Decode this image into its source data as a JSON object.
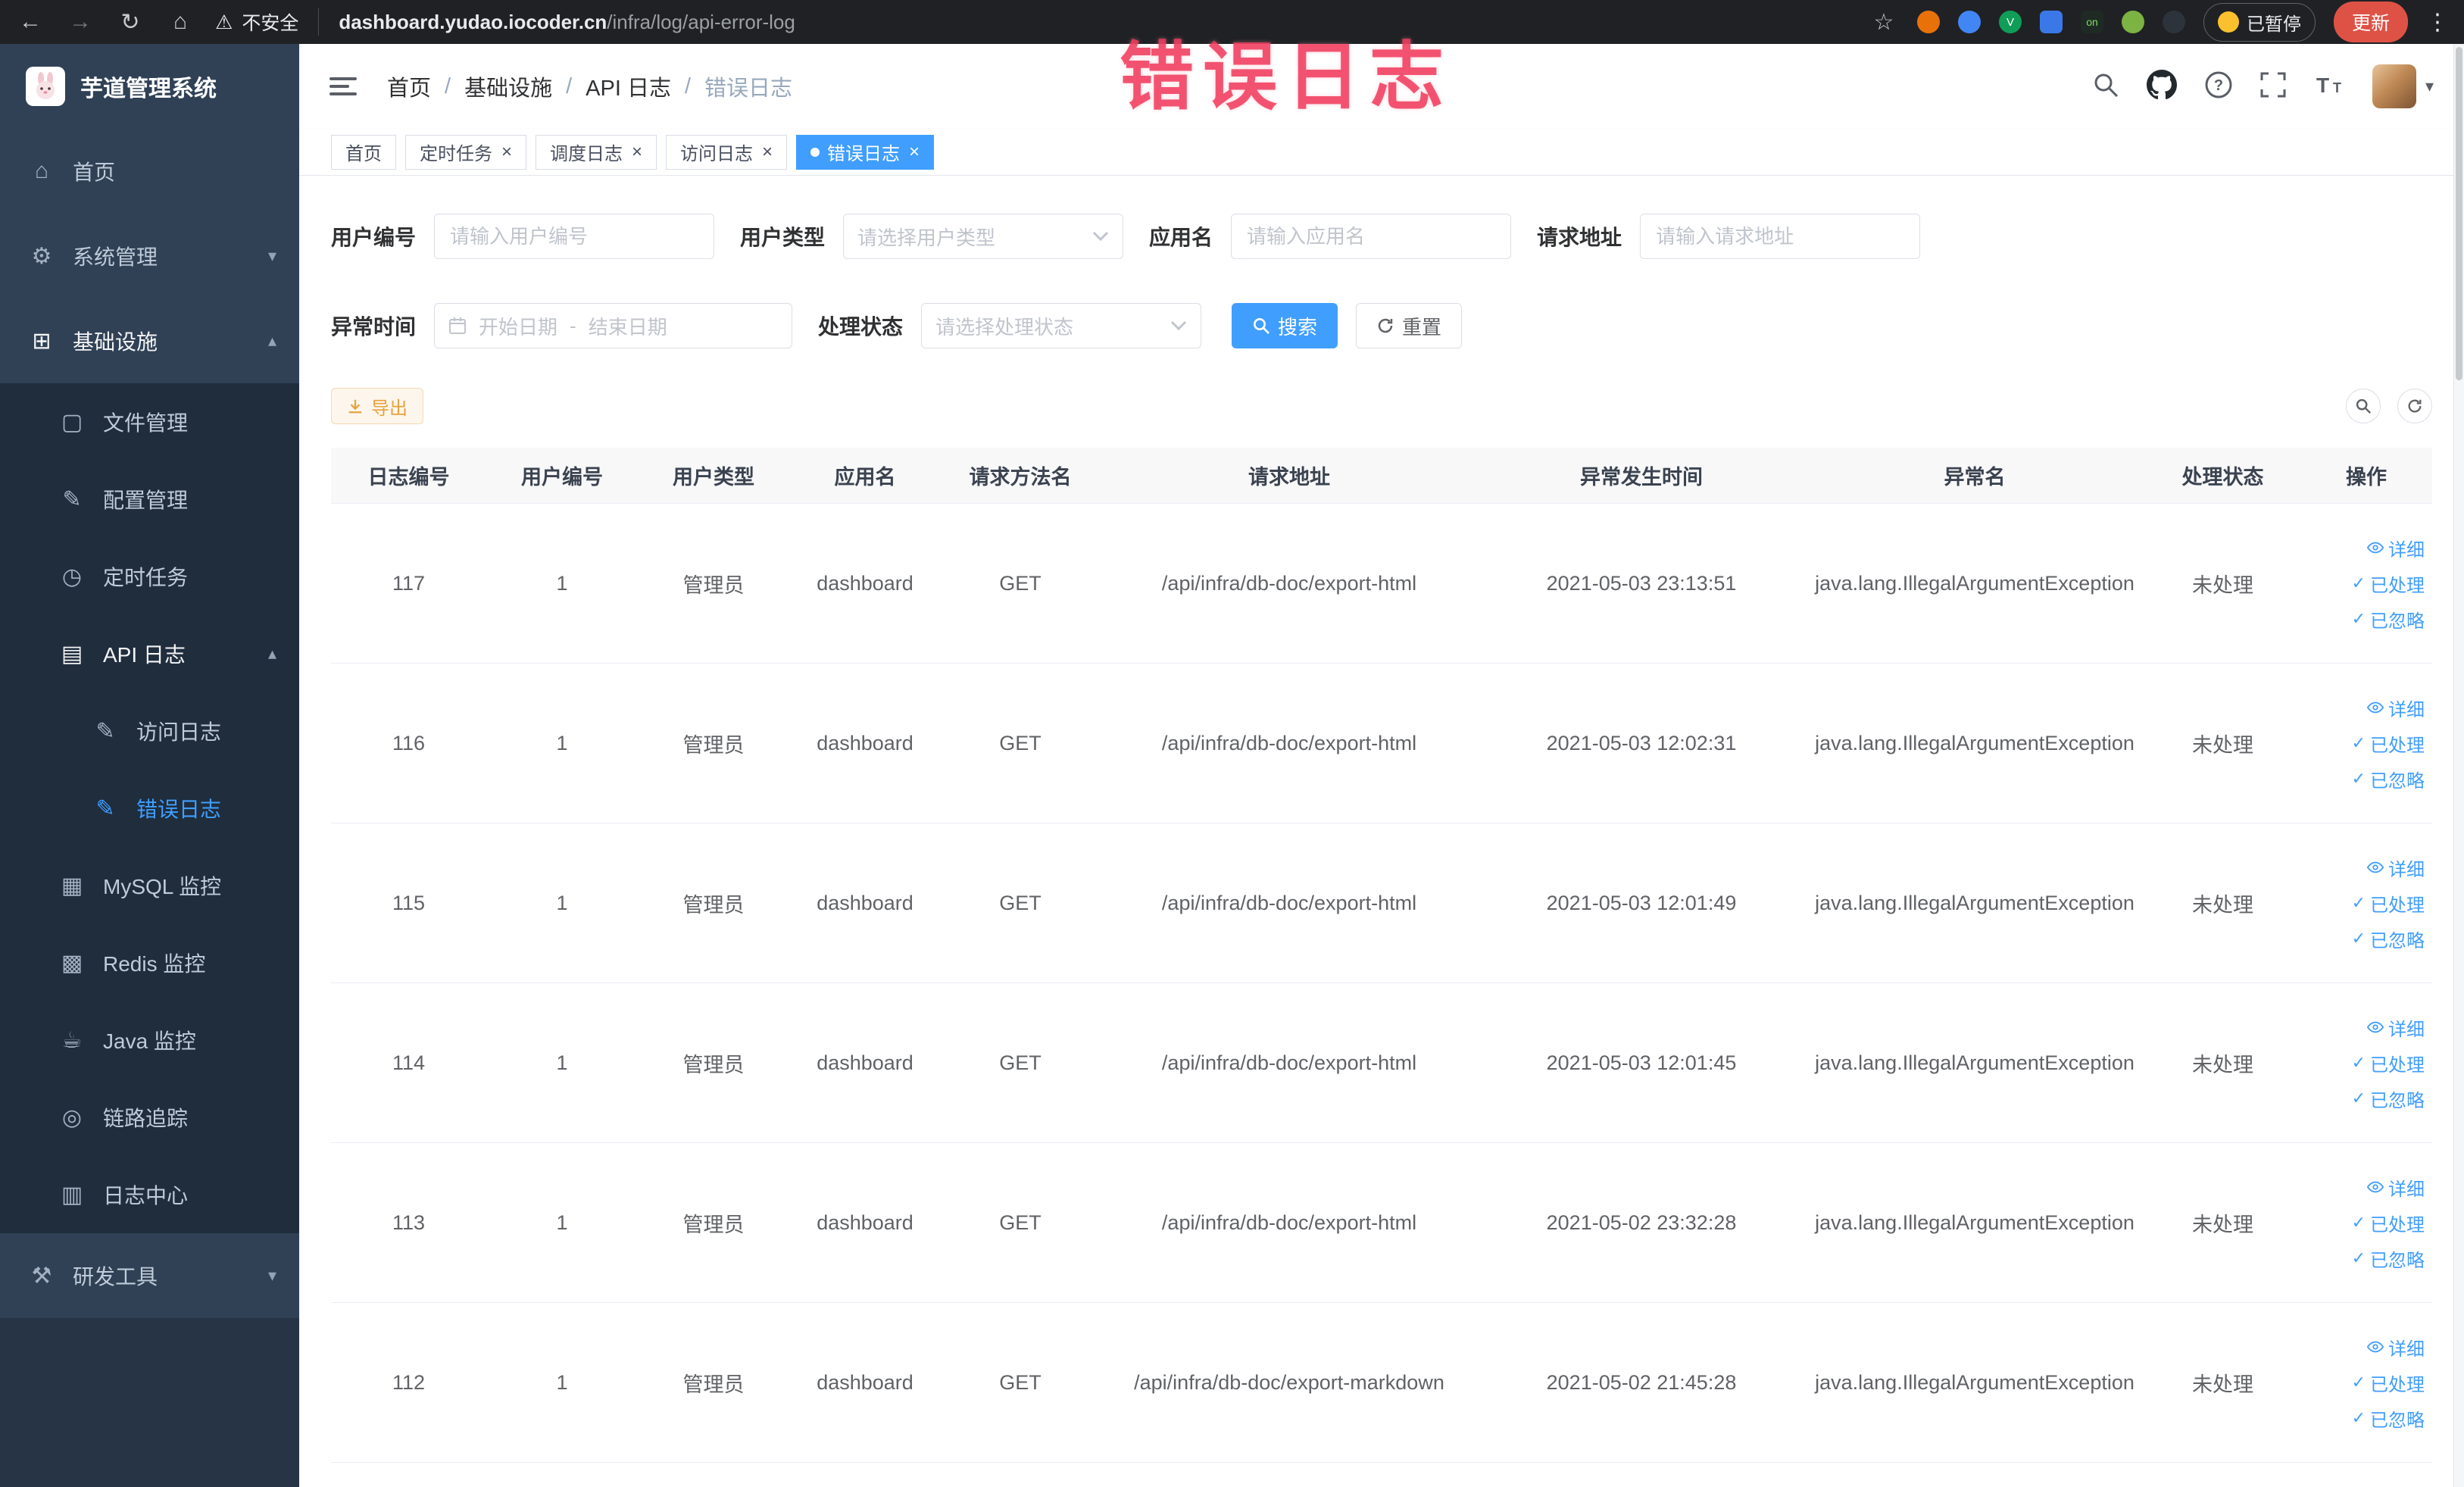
{
  "colors": {
    "accent": "#409EFF",
    "sidebar_bg": "#304156",
    "submenu_bg": "#1f2d3d",
    "warning": "#e6a23c",
    "annotation": "#f03a5c"
  },
  "browser": {
    "security_label": "不安全",
    "url_domain": "dashboard.yudao.iocoder.cn",
    "url_path": "/infra/log/api-error-log",
    "on_badge": "on",
    "paused_label": "已暂停",
    "update_label": "更新"
  },
  "icons": {
    "back": "←",
    "forward": "→",
    "reload": "↻",
    "home": "⌂",
    "warning": "⚠",
    "star": "☆",
    "kebab": "⋮",
    "close": "×",
    "check": "✓",
    "caret_down": "▾",
    "caret_up": "▴",
    "menu_home": "⌂",
    "menu_system": "⚙",
    "menu_infra": "⊞",
    "menu_file": "▢",
    "menu_config": "✎",
    "menu_job": "◷",
    "menu_api": "▤",
    "menu_edit": "✎",
    "menu_mysql": "▦",
    "menu_redis": "▩",
    "menu_java": "☕",
    "menu_trace": "◎",
    "menu_log": "▥",
    "menu_tools": "⚒"
  },
  "annotation": {
    "text": "错误日志"
  },
  "sidebar": {
    "title": "芋道管理系统",
    "home": "首页",
    "system": "系统管理",
    "infra": "基础设施",
    "file": "文件管理",
    "config": "配置管理",
    "job": "定时任务",
    "api_log": "API 日志",
    "access_log": "访问日志",
    "error_log": "错误日志",
    "mysql": "MySQL 监控",
    "redis": "Redis 监控",
    "java": "Java 监控",
    "trace": "链路追踪",
    "log_center": "日志中心",
    "dev_tools": "研发工具"
  },
  "breadcrumb": {
    "separator": "/",
    "items": [
      "首页",
      "基础设施",
      "API 日志",
      "错误日志"
    ]
  },
  "tabs": [
    {
      "label": "首页"
    },
    {
      "label": "定时任务"
    },
    {
      "label": "调度日志"
    },
    {
      "label": "访问日志"
    },
    {
      "label": "错误日志"
    }
  ],
  "filters": {
    "user_id_label": "用户编号",
    "user_id_placeholder": "请输入用户编号",
    "user_type_label": "用户类型",
    "user_type_placeholder": "请选择用户类型",
    "app_name_label": "应用名",
    "app_name_placeholder": "请输入应用名",
    "request_url_label": "请求地址",
    "request_url_placeholder": "请输入请求地址",
    "exception_time_label": "异常时间",
    "start_date_placeholder": "开始日期",
    "date_separator": "-",
    "end_date_placeholder": "结束日期",
    "process_status_label": "处理状态",
    "process_status_placeholder": "请选择处理状态",
    "search_label": "搜索",
    "reset_label": "重置"
  },
  "toolbar": {
    "export_label": "导出"
  },
  "table": {
    "columns": [
      "日志编号",
      "用户编号",
      "用户类型",
      "应用名",
      "请求方法名",
      "请求地址",
      "异常发生时间",
      "异常名",
      "处理状态",
      "操作"
    ],
    "actions": {
      "detail": "详细",
      "processed": "已处理",
      "ignored": "已忽略"
    },
    "rows": [
      {
        "id": "117",
        "user_id": "1",
        "user_type": "管理员",
        "app": "dashboard",
        "method": "GET",
        "url": "/api/infra/db-doc/export-html",
        "time": "2021-05-03 23:13:51",
        "exception": "java.lang.IllegalArgumentException",
        "status": "未处理"
      },
      {
        "id": "116",
        "user_id": "1",
        "user_type": "管理员",
        "app": "dashboard",
        "method": "GET",
        "url": "/api/infra/db-doc/export-html",
        "time": "2021-05-03 12:02:31",
        "exception": "java.lang.IllegalArgumentException",
        "status": "未处理"
      },
      {
        "id": "115",
        "user_id": "1",
        "user_type": "管理员",
        "app": "dashboard",
        "method": "GET",
        "url": "/api/infra/db-doc/export-html",
        "time": "2021-05-03 12:01:49",
        "exception": "java.lang.IllegalArgumentException",
        "status": "未处理"
      },
      {
        "id": "114",
        "user_id": "1",
        "user_type": "管理员",
        "app": "dashboard",
        "method": "GET",
        "url": "/api/infra/db-doc/export-html",
        "time": "2021-05-03 12:01:45",
        "exception": "java.lang.IllegalArgumentException",
        "status": "未处理"
      },
      {
        "id": "113",
        "user_id": "1",
        "user_type": "管理员",
        "app": "dashboard",
        "method": "GET",
        "url": "/api/infra/db-doc/export-html",
        "time": "2021-05-02 23:32:28",
        "exception": "java.lang.IllegalArgumentException",
        "status": "未处理"
      },
      {
        "id": "112",
        "user_id": "1",
        "user_type": "管理员",
        "app": "dashboard",
        "method": "GET",
        "url": "/api/infra/db-doc/export-markdown",
        "time": "2021-05-02 21:45:28",
        "exception": "java.lang.IllegalArgumentException",
        "status": "未处理"
      }
    ]
  }
}
